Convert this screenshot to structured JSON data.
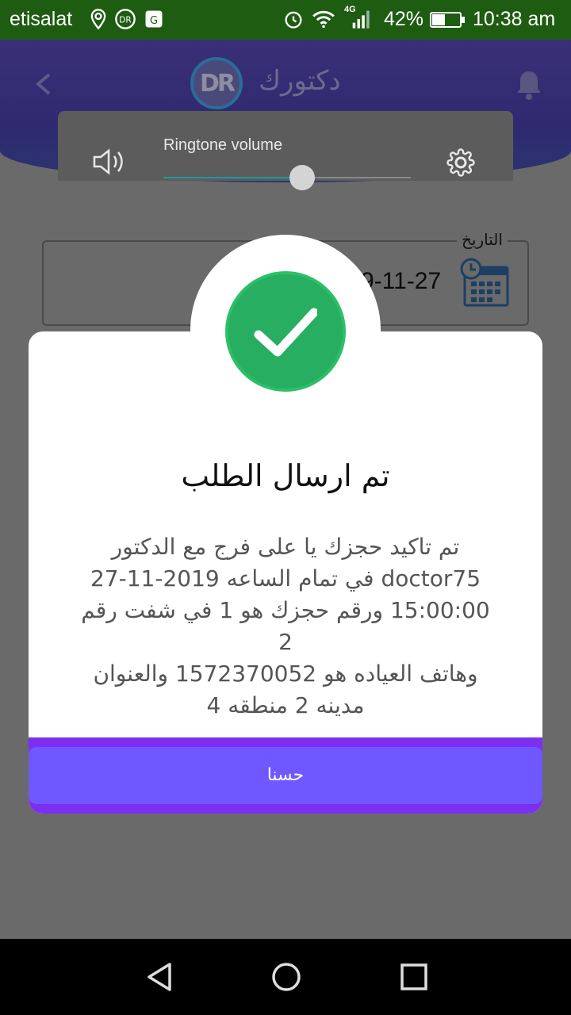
{
  "status_bar": {
    "carrier": "etisalat",
    "network": "4G",
    "battery": "42%",
    "time": "10:38 am"
  },
  "header": {
    "logo_text": "DR",
    "title": "دكتورك"
  },
  "volume": {
    "label": "Ringtone volume",
    "level": 0.56
  },
  "date_field": {
    "label": "التاريخ",
    "value": "9-11-27"
  },
  "modal": {
    "title": "تم ارسال الطلب",
    "message_lines": [
      "تم تاكيد حجزك يا على فرج مع الدكتور",
      "doctor75 في تمام الساعه 2019-11-27",
      "15:00:00 ورقم حجزك هو 1 في شفت رقم 2",
      "وهاتف العياده هو 1572370052 والعنوان",
      "مدينه 2 منطقه 4"
    ],
    "ok_label": "حسنا"
  },
  "colors": {
    "status_bar": "#1e5c12",
    "success": "#27ae60",
    "button": "#6f58ff",
    "footer": "#7c2ff0"
  }
}
